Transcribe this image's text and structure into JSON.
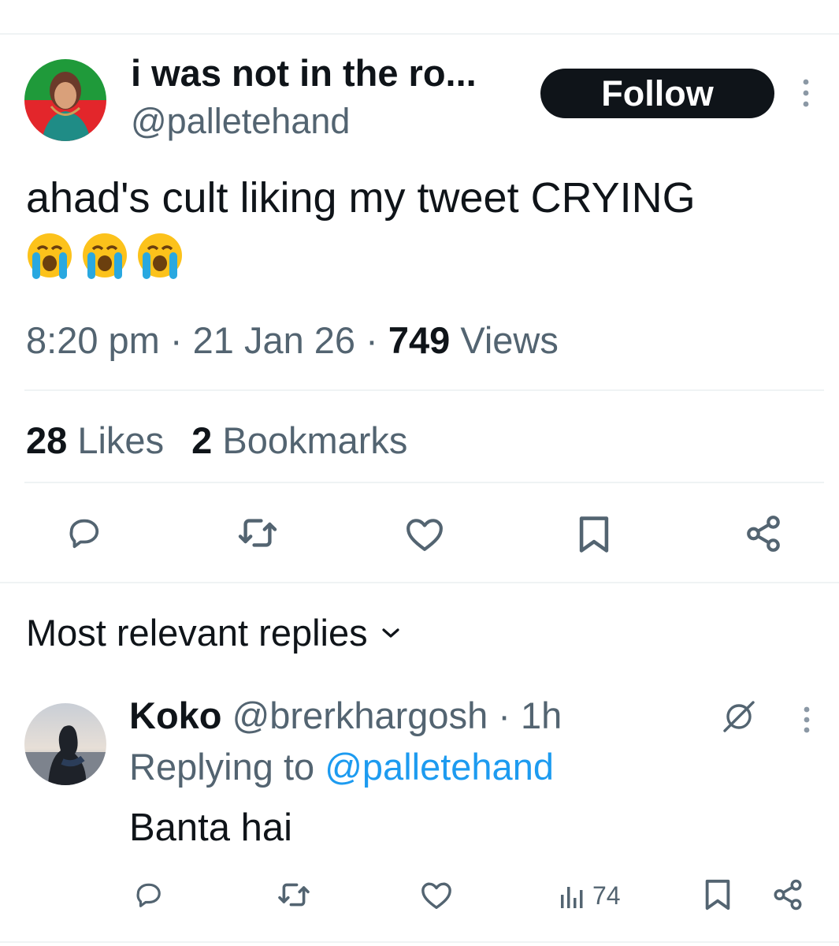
{
  "tweet": {
    "display_name": "i was not in the ro...",
    "handle": "@palletehand",
    "follow_label": "Follow",
    "text": "ahad's cult liking my tweet CRYING",
    "emoji_count": 3,
    "time": "8:20 pm",
    "sep1": "·",
    "date": "21 Jan 26",
    "sep2": "·",
    "views_count": "749",
    "views_label": "Views",
    "likes_count": "28",
    "likes_label": "Likes",
    "bookmarks_count": "2",
    "bookmarks_label": "Bookmarks"
  },
  "replies_header": {
    "label": "Most relevant replies"
  },
  "reply": {
    "name": "Koko",
    "handle": "@brerkhargosh",
    "sep": "·",
    "age": "1h",
    "replying_prefix": "Replying to",
    "replying_handle": "@palletehand",
    "text": "Banta hai",
    "views": "74"
  },
  "colors": {
    "text": "#0f1419",
    "secondary": "#536471",
    "link": "#1d9bf0",
    "divider": "#eff3f4",
    "follow_bg": "#0f1419"
  },
  "icons": {
    "reply": "speech-bubble-icon",
    "repost": "repost-arrows-icon",
    "like": "heart-icon",
    "bookmark": "bookmark-icon",
    "share": "share-nodes-icon",
    "views": "bar-chart-icon",
    "more": "vertical-ellipsis-icon",
    "grok": "grok-slash-circle-icon",
    "chevron": "chevron-down-icon"
  }
}
